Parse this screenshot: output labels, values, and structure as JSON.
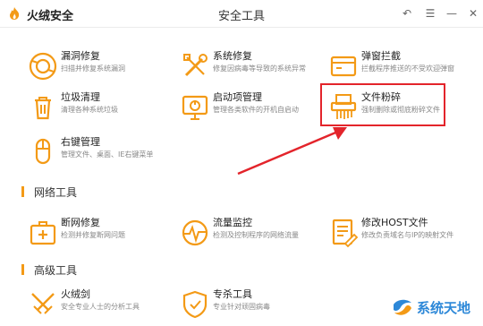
{
  "app": {
    "name": "火绒安全",
    "window_title": "安全工具"
  },
  "window_controls": {
    "back": "↶",
    "menu": "☰",
    "minimize": "—",
    "close": "✕"
  },
  "sections": [
    {
      "title": ""
    },
    {
      "title": "网络工具"
    },
    {
      "title": "高级工具"
    }
  ],
  "tools": {
    "loophole": {
      "title": "漏洞修复",
      "desc": "扫描并修复系统漏洞"
    },
    "sysrepair": {
      "title": "系统修复",
      "desc": "修复因病毒等导致的系统异常"
    },
    "popup": {
      "title": "弹窗拦截",
      "desc": "拦截程序推送的不受欢迎弹窗"
    },
    "garbage": {
      "title": "垃圾清理",
      "desc": "清理各种系统垃圾"
    },
    "startup": {
      "title": "启动项管理",
      "desc": "管理各类软件的开机自启动"
    },
    "shredder": {
      "title": "文件粉碎",
      "desc": "强制删除或彻底粉碎文件"
    },
    "rightclick": {
      "title": "右键管理",
      "desc": "管理文件、桌面、IE右键菜单"
    },
    "netrepair": {
      "title": "断网修复",
      "desc": "检测并修复断网问题"
    },
    "traffic": {
      "title": "流量监控",
      "desc": "检测及控制程序的网络流量"
    },
    "hosts": {
      "title": "修改HOST文件",
      "desc": "修改负责域名与IP的映射文件"
    },
    "huorongjian": {
      "title": "火绒剑",
      "desc": "安全专业人士的分析工具"
    },
    "special": {
      "title": "专杀工具",
      "desc": "专业针对顽固病毒"
    }
  },
  "watermark": {
    "text": "系统天地"
  },
  "colors": {
    "accent": "#f39a16",
    "highlight": "#e3242b",
    "watermark": "#2d88d8"
  }
}
